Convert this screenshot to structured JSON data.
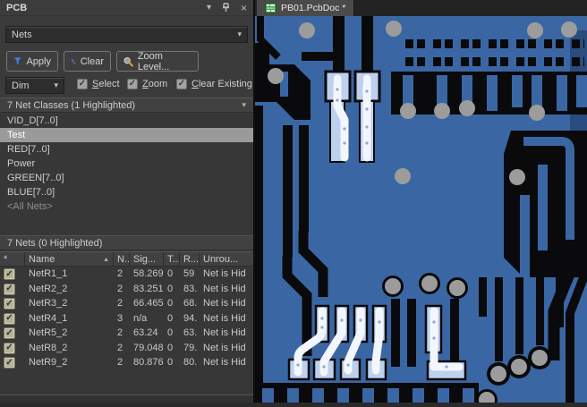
{
  "icons": {
    "chevron_down": "▾",
    "close": "×",
    "check": "✓",
    "sort_asc": "▲"
  },
  "panel": {
    "title": "PCB",
    "mode_selector": {
      "value": "Nets"
    },
    "toolbar": {
      "apply_label": "Apply",
      "clear_label": "Clear",
      "zoom_level_label": "Zoom Level..."
    },
    "dim_row": {
      "value": "Dim",
      "checkboxes": [
        {
          "hotkey": "S",
          "rest": "elect",
          "checked": true
        },
        {
          "hotkey": "Z",
          "rest": "oom",
          "checked": true
        },
        {
          "hotkey": "C",
          "rest": "lear Existing",
          "checked": true
        }
      ]
    },
    "net_classes": {
      "header": "7 Net Classes (1 Highlighted)",
      "items": [
        {
          "label": "VID_D[7..0]"
        },
        {
          "label": "Test",
          "selected": true
        },
        {
          "label": "RED[7..0]"
        },
        {
          "label": "Power"
        },
        {
          "label": "GREEN[7..0]"
        },
        {
          "label": "BLUE[7..0]"
        },
        {
          "label": "<All Nets>",
          "dimmed": true
        }
      ]
    },
    "nets": {
      "header": "7 Nets (0 Highlighted)",
      "columns": {
        "mark": "*",
        "name": "Name",
        "nodes": "N..",
        "signal": "Sig...",
        "t": "T...",
        "routed": "R...",
        "unrouted": "Unrou..."
      },
      "rows": [
        {
          "checked": true,
          "name": "NetR1_1",
          "nodes": "2",
          "signal": "58.269",
          "t": "0",
          "r": "59",
          "unrouted": "Net is Hid"
        },
        {
          "checked": true,
          "name": "NetR2_2",
          "nodes": "2",
          "signal": "83.251",
          "t": "0",
          "r": "83.",
          "unrouted": "Net is Hid"
        },
        {
          "checked": true,
          "name": "NetR3_2",
          "nodes": "2",
          "signal": "66.465",
          "t": "0",
          "r": "68.",
          "unrouted": "Net is Hid"
        },
        {
          "checked": true,
          "name": "NetR4_1",
          "nodes": "3",
          "signal": "n/a",
          "t": "0",
          "r": "94.",
          "unrouted": "Net is Hid"
        },
        {
          "checked": true,
          "name": "NetR5_2",
          "nodes": "2",
          "signal": "63.24",
          "t": "0",
          "r": "63.",
          "unrouted": "Net is Hid"
        },
        {
          "checked": true,
          "name": "NetR8_2",
          "nodes": "2",
          "signal": "79.048",
          "t": "0",
          "r": "79.",
          "unrouted": "Net is Hid"
        },
        {
          "checked": true,
          "name": "NetR9_2",
          "nodes": "2",
          "signal": "80.876",
          "t": "0",
          "r": "80.",
          "unrouted": "Net is Hid"
        }
      ]
    }
  },
  "main": {
    "tab": {
      "label": "PB01.PcbDoc *"
    }
  },
  "colors": {
    "funnel_blue": "#4d82d6",
    "clear_x_red": "#c84a3e",
    "magnifier_gold": "#d8a43e",
    "tab_icon_green": "#3f9e4d",
    "selection_gray": "#9a9a9a",
    "board_blue": "#3a67a4",
    "board_blue_dark": "#2b4c7e",
    "board_black": "#0a0a0c",
    "pad_light_blue": "#bdd0ee",
    "net_highlight_white": "#f3f6fc",
    "via_gray": "#9c9c9c",
    "panel_text": "#cfcfcf"
  }
}
